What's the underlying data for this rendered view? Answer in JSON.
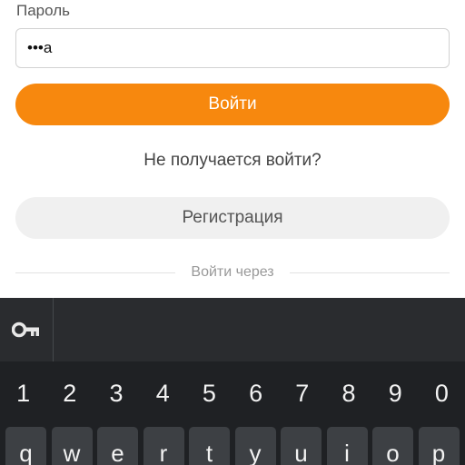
{
  "form": {
    "password_label": "Пароль",
    "password_value": "•••а",
    "login_label": "Войти",
    "forgot_label": "Не получается войти?",
    "register_label": "Регистрация",
    "login_via_label": "Войти через",
    "accent_color": "#f7880e"
  },
  "keyboard": {
    "toolbar_icon": "key-icon",
    "number_keys": [
      "1",
      "2",
      "3",
      "4",
      "5",
      "6",
      "7",
      "8",
      "9",
      "0"
    ],
    "letter_keys": [
      "q",
      "w",
      "e",
      "r",
      "t",
      "y",
      "u",
      "i",
      "o",
      "p"
    ]
  }
}
